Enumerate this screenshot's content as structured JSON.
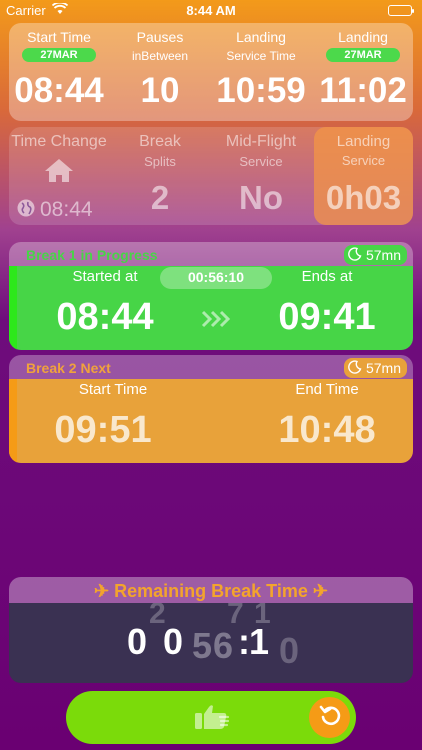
{
  "status_bar": {
    "carrier": "Carrier",
    "time": "8:44 AM"
  },
  "top_card": {
    "start_time": {
      "label": "Start Time",
      "date": "27MAR",
      "value": "08:44"
    },
    "pauses": {
      "label": "Pauses",
      "sub": "inBetween",
      "value": "10"
    },
    "landing_service": {
      "label": "Landing",
      "sub": "Service Time",
      "value": "10:59"
    },
    "landing": {
      "label": "Landing",
      "date": "27MAR",
      "value": "11:02"
    }
  },
  "mid_card": {
    "time_change": {
      "label": "Time Change",
      "value": "08:44",
      "icon": "house-icon"
    },
    "break_splits": {
      "label": "Break",
      "sub": "Splits",
      "value": "2"
    },
    "mid_flight": {
      "label": "Mid-Flight",
      "sub": "Service",
      "value": "No"
    },
    "landing_service": {
      "label": "Landing",
      "sub": "Service",
      "value": "0h03"
    }
  },
  "break1": {
    "title": "Break 1 in Progress",
    "duration": "57mn",
    "started_label": "Started at",
    "elapsed": "00:56:10",
    "ends_label": "Ends at",
    "start": "08:44",
    "end": "09:41",
    "color": "#47d547"
  },
  "break2": {
    "title": "Break 2 Next",
    "duration": "57mn",
    "start_label": "Start Time",
    "end_label": "End Time",
    "start": "09:51",
    "end": "10:48",
    "color": "#e8a23a"
  },
  "remaining": {
    "title": "✈ Remaining Break Time ✈",
    "ghost_top": [
      "2",
      "7",
      "1"
    ],
    "digits": [
      "0",
      "0",
      ":",
      "1"
    ],
    "ghost_mid": [
      "5",
      "6"
    ],
    "ghost_end": "0"
  },
  "colors": {
    "accent_orange": "#f59b16",
    "accent_green": "#7bdb0a"
  }
}
